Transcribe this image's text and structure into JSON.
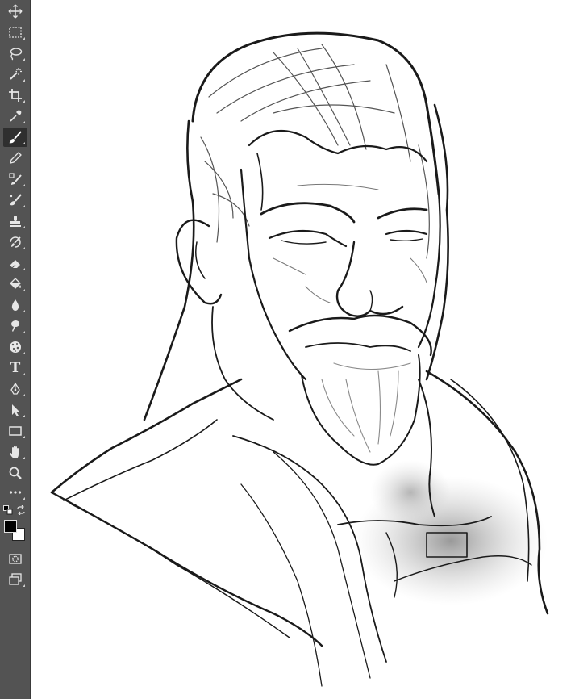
{
  "toolbar": {
    "tools": [
      {
        "name": "move-tool",
        "icon": "move-icon"
      },
      {
        "name": "marquee-tool",
        "icon": "rect-marquee-icon"
      },
      {
        "name": "lasso-tool",
        "icon": "lasso-icon"
      },
      {
        "name": "magic-wand-tool",
        "icon": "magic-wand-icon"
      },
      {
        "name": "crop-tool",
        "icon": "crop-icon"
      },
      {
        "name": "eyedropper-tool",
        "icon": "eyedropper-icon"
      },
      {
        "name": "brush-tool",
        "icon": "brush-icon",
        "active": true
      },
      {
        "name": "pencil-tool",
        "icon": "pencil-icon"
      },
      {
        "name": "clone-stamp-tool",
        "icon": "clone-stamp-icon"
      },
      {
        "name": "mixer-brush-tool",
        "icon": "mixer-brush-icon"
      },
      {
        "name": "stamp-tool",
        "icon": "stamp-icon"
      },
      {
        "name": "history-brush-tool",
        "icon": "history-brush-icon"
      },
      {
        "name": "eraser-tool",
        "icon": "eraser-icon"
      },
      {
        "name": "paint-bucket-tool",
        "icon": "paint-bucket-icon"
      },
      {
        "name": "blur-tool",
        "icon": "drop-icon"
      },
      {
        "name": "smudge-tool",
        "icon": "smudge-icon"
      },
      {
        "name": "sponge-tool",
        "icon": "sponge-icon"
      },
      {
        "name": "type-tool",
        "icon": "type-icon",
        "label": "T"
      },
      {
        "name": "pen-tool",
        "icon": "pen-icon"
      },
      {
        "name": "path-selection-tool",
        "icon": "arrow-icon"
      },
      {
        "name": "rectangle-tool",
        "icon": "rectangle-icon"
      },
      {
        "name": "hand-tool",
        "icon": "hand-icon"
      },
      {
        "name": "zoom-tool",
        "icon": "zoom-icon"
      },
      {
        "name": "more-tools",
        "icon": "ellipsis-icon"
      }
    ],
    "foreground_color": "#000000",
    "background_color": "#ffffff",
    "toolbar_color": "#535353"
  },
  "canvas": {
    "background": "#ffffff",
    "content": "sketch-artwork"
  }
}
